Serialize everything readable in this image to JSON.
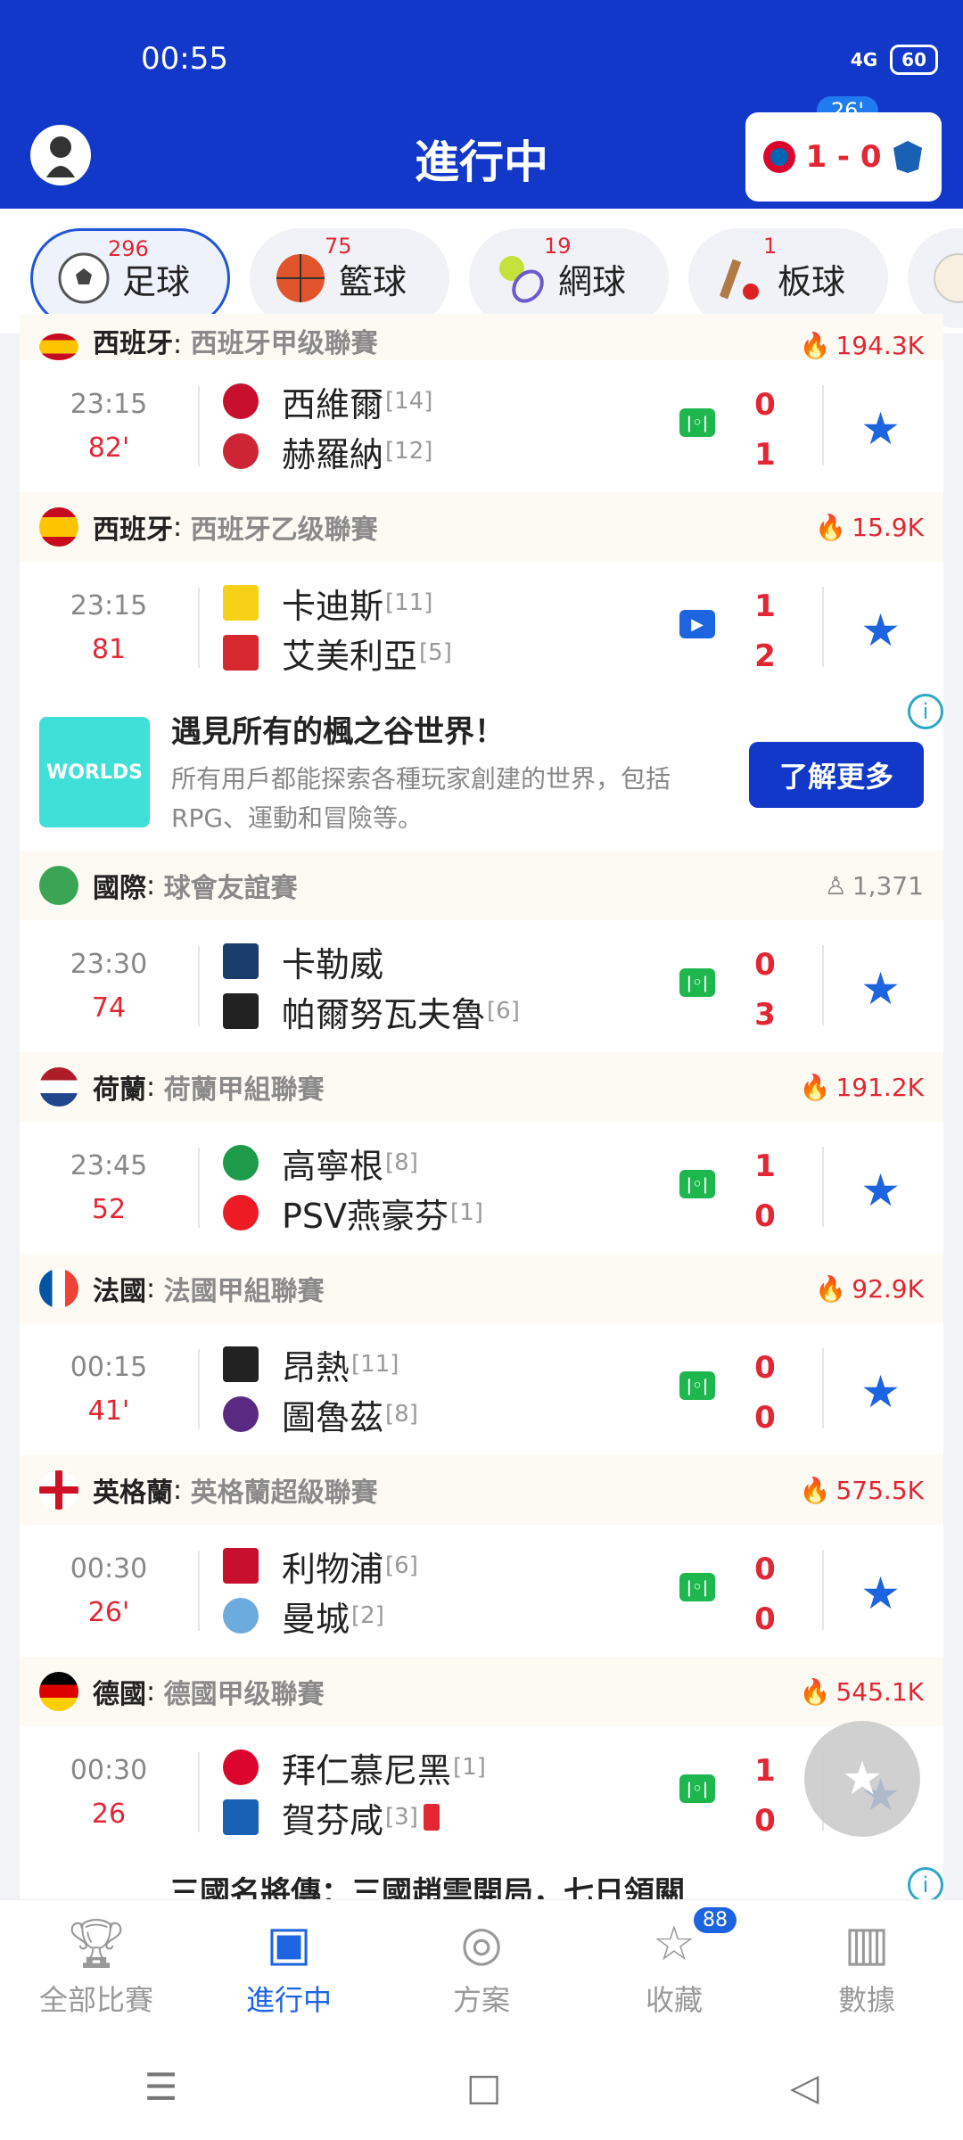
{
  "status": {
    "time": "00:55",
    "network": "4G",
    "battery": "60"
  },
  "header": {
    "title": "進行中",
    "live_match": {
      "minute": "26'",
      "score": "1 - 0"
    }
  },
  "sports_tabs": [
    {
      "label": "足球",
      "count": "296",
      "active": true
    },
    {
      "label": "籃球",
      "count": "75"
    },
    {
      "label": "網球",
      "count": "19"
    },
    {
      "label": "板球",
      "count": "1"
    }
  ],
  "leagues": [
    {
      "country": "西班牙",
      "league": "西班牙甲级聯賽",
      "heat": "194.3K",
      "match": {
        "kickoff": "23:15",
        "minute": "82'",
        "home": "西維爾",
        "home_rank": "[14]",
        "away": "赫羅納",
        "away_rank": "[12]",
        "home_score": "0",
        "away_score": "1"
      }
    },
    {
      "country": "西班牙",
      "league": "西班牙乙级聯賽",
      "heat": "15.9K",
      "match": {
        "kickoff": "23:15",
        "minute": "81",
        "home": "卡迪斯",
        "home_rank": "[11]",
        "away": "艾美利亞",
        "away_rank": "[5]",
        "home_score": "1",
        "away_score": "2"
      }
    },
    {
      "country": "國際",
      "league": "球會友誼賽",
      "heat": "1,371",
      "match": {
        "kickoff": "23:30",
        "minute": "74",
        "home": "卡勒威",
        "home_rank": "",
        "away": "帕爾努瓦夫魯",
        "away_rank": "[6]",
        "home_score": "0",
        "away_score": "3"
      }
    },
    {
      "country": "荷蘭",
      "league": "荷蘭甲組聯賽",
      "heat": "191.2K",
      "match": {
        "kickoff": "23:45",
        "minute": "52",
        "home": "高寧根",
        "home_rank": "[8]",
        "away": "PSV燕豪芬",
        "away_rank": "[1]",
        "home_score": "1",
        "away_score": "0"
      }
    },
    {
      "country": "法國",
      "league": "法國甲組聯賽",
      "heat": "92.9K",
      "match": {
        "kickoff": "00:15",
        "minute": "41'",
        "home": "昂熱",
        "home_rank": "[11]",
        "away": "圖魯茲",
        "away_rank": "[8]",
        "home_score": "0",
        "away_score": "0"
      }
    },
    {
      "country": "英格蘭",
      "league": "英格蘭超級聯賽",
      "heat": "575.5K",
      "match": {
        "kickoff": "00:30",
        "minute": "26'",
        "home": "利物浦",
        "home_rank": "[6]",
        "away": "曼城",
        "away_rank": "[2]",
        "home_score": "0",
        "away_score": "0"
      }
    },
    {
      "country": "德國",
      "league": "德國甲级聯賽",
      "heat": "545.1K",
      "match": {
        "kickoff": "00:30",
        "minute": "26",
        "home": "拜仁慕尼黑",
        "home_rank": "[1]",
        "away": "賀芬咸",
        "away_rank": "[3]",
        "home_score": "1",
        "away_score": "0"
      }
    }
  ],
  "ad": {
    "thumb_text": "WORLDS",
    "title": "遇見所有的楓之谷世界！",
    "body": "所有用戶都能探索各種玩家創建的世界，包括RPG、運動和冒險等。",
    "cta": "了解更多"
  },
  "ad2_title": "三國名將傳：三國趙雲開局，七日領關",
  "bottom_nav": [
    {
      "label": "全部比賽",
      "icon": "trophy-icon"
    },
    {
      "label": "進行中",
      "icon": "live-icon",
      "active": true
    },
    {
      "label": "方案",
      "icon": "target-icon"
    },
    {
      "label": "收藏",
      "icon": "star-icon",
      "badge": "88"
    },
    {
      "label": "數據",
      "icon": "chart-icon"
    }
  ]
}
